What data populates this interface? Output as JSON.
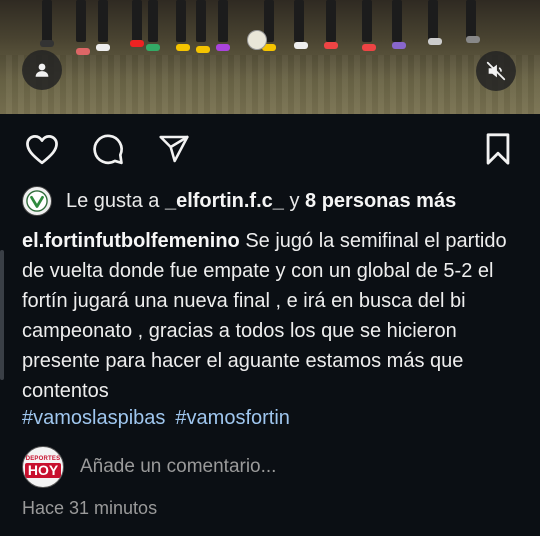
{
  "post": {
    "media": {
      "user_icon": "person-icon",
      "mute_icon": "speaker-muted-icon"
    },
    "actions": {
      "like_icon": "heart-icon",
      "comment_icon": "comment-bubble-icon",
      "share_icon": "paper-plane-icon",
      "save_icon": "bookmark-icon"
    },
    "likes": {
      "prefix": "Le gusta a ",
      "user": "_elfortin.f.c_",
      "middle": " y ",
      "others": "8 personas más"
    },
    "caption": {
      "username": "el.fortinfutbolfemenino",
      "text": " Se jugó la semifinal el partido de vuelta donde fue empate y con un global de 5-2 el fortín jugará una nueva final , e irá en busca del bi campeonato , gracias a todos los que se hicieron presente para hacer el aguante estamos más que contentos",
      "hashtags": [
        "#vamoslaspibas",
        "#vamosfortin"
      ]
    },
    "comment": {
      "avatar_top": "DEPORTES",
      "avatar_main": "HOY",
      "placeholder": "Añade un comentario..."
    },
    "timestamp": "Hace 31 minutos"
  },
  "colors": {
    "background": "#0b0f14",
    "hashtag": "#9fc6ee",
    "muted_text": "#9a9a9a",
    "brand_red": "#c8102e"
  }
}
